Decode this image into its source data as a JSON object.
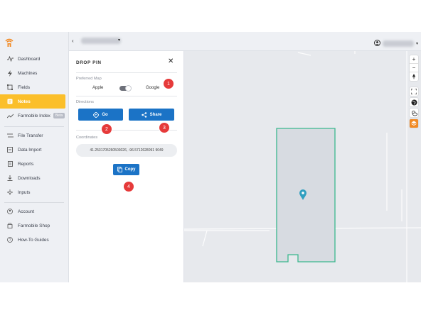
{
  "sidebar": {
    "items": [
      {
        "label": "Dashboard",
        "icon": "pulse-icon"
      },
      {
        "label": "Machines",
        "icon": "lightning-icon"
      },
      {
        "label": "Fields",
        "icon": "field-icon"
      },
      {
        "label": "Notes",
        "icon": "note-icon",
        "active": true
      },
      {
        "label": "Farmobile Index",
        "icon": "trend-icon",
        "badge": "Beta"
      },
      {
        "label": "File Transfer",
        "icon": "transfer-icon"
      },
      {
        "label": "Data Import",
        "icon": "import-icon"
      },
      {
        "label": "Reports",
        "icon": "report-icon"
      },
      {
        "label": "Downloads",
        "icon": "download-icon"
      },
      {
        "label": "Inputs",
        "icon": "inputs-icon"
      },
      {
        "label": "Account",
        "icon": "account-icon"
      },
      {
        "label": "Farmobile Shop",
        "icon": "shop-icon"
      },
      {
        "label": "How-To Guides",
        "icon": "help-icon"
      }
    ]
  },
  "topbar": {
    "back_symbol": "‹",
    "caret_symbol": "▾"
  },
  "panel": {
    "title": "DROP PIN",
    "close_symbol": "✕",
    "preferred_map_label": "Preferred Map",
    "map_option_left": "Apple",
    "map_option_right": "Google",
    "directions_label": "Directions",
    "go_label": "Go",
    "share_label": "Share",
    "coordinates_label": "Coordinates",
    "coordinates_value": "41.2531705260503026, -96.5712628091 9049",
    "copy_label": "Copy"
  },
  "badges": [
    "1",
    "2",
    "3",
    "4"
  ],
  "map": {
    "zoom_in": "+",
    "zoom_out": "−",
    "field_outline_color": "#3bb88e",
    "pin_color": "#2f9fc0"
  },
  "colors": {
    "accent_active": "#fbbf2a",
    "primary_button": "#1b73c6",
    "badge": "#e63a3a",
    "layers_button": "#f18a25"
  }
}
